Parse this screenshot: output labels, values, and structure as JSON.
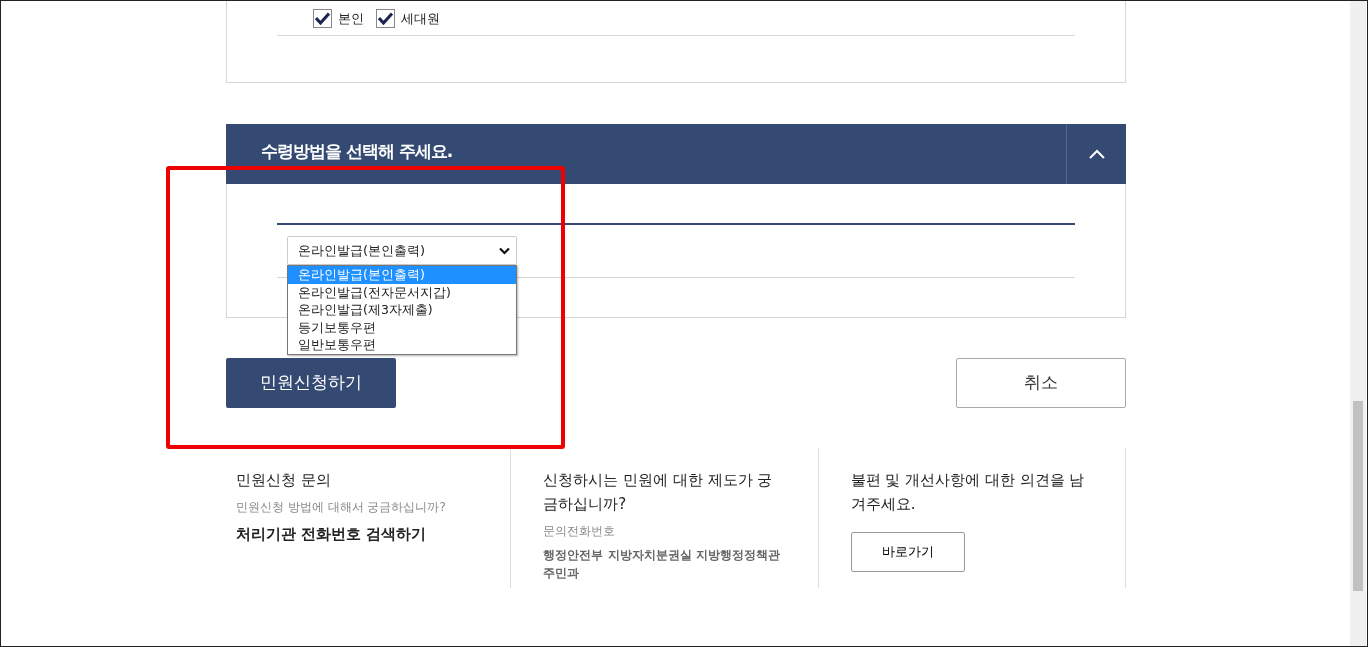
{
  "household_card": {
    "checkboxes": [
      {
        "label": "본인",
        "checked": true
      },
      {
        "label": "세대원",
        "checked": true
      }
    ]
  },
  "receipt_section": {
    "title": "수령방법을 선택해 주세요.",
    "expanded": true,
    "select": {
      "value": "온라인발급(본인출력)",
      "open": true,
      "options": [
        {
          "label": "온라인발급(본인출력)",
          "selected": true
        },
        {
          "label": "온라인발급(전자문서지갑)",
          "selected": false
        },
        {
          "label": "온라인발급(제3자제출)",
          "selected": false
        },
        {
          "label": "등기보통우편",
          "selected": false
        },
        {
          "label": "일반보통우편",
          "selected": false
        }
      ]
    }
  },
  "buttons": [
    {
      "label": "민원신청하기",
      "kind": "primary"
    },
    {
      "label": "취소",
      "kind": "secondary"
    }
  ],
  "footer": [
    {
      "items": [
        {
          "kind": "title",
          "text": "민원신청 문의"
        },
        {
          "kind": "note",
          "text": "민원신청 방법에 대해서 궁금하십니까?"
        },
        {
          "kind": "link",
          "text": "처리기관 전화번호 검색하기"
        }
      ]
    },
    {
      "items": [
        {
          "kind": "title",
          "text": "신청하시는 민원에 대한 제도가 궁금하십니까?"
        },
        {
          "kind": "note",
          "text": "문의전화번호"
        },
        {
          "kind": "detail",
          "text": "행정안전부 지방자치분권실 지방행정정책관 주민과"
        }
      ]
    },
    {
      "items": [
        {
          "kind": "title",
          "text": "불편 및 개선사항에 대한 의견을 남겨주세요."
        },
        {
          "kind": "button",
          "text": "바로가기"
        }
      ]
    }
  ]
}
